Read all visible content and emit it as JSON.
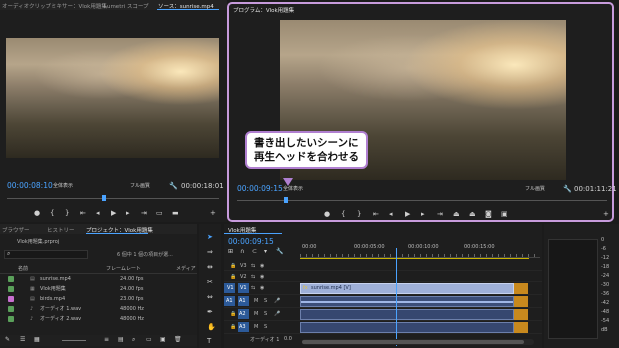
{
  "source_panel": {
    "tabs": [
      "オーディオクリップミキサー：Vlok用題集",
      "Lumetri スコープ",
      "ソース：sunrise.mp4"
    ],
    "timecode_left": "00:00:08:10",
    "fit_label": "全体表示",
    "quality_label": "フル画質",
    "timecode_right": "00:00:18:01"
  },
  "program_panel": {
    "tab": "プログラム：Vlok用題集",
    "timecode_left": "00:00:09:15",
    "fit_label": "全体表示",
    "quality_label": "フル画質",
    "timecode_right": "00:01:11:21"
  },
  "callout": {
    "line1": "書き出したいシーンに",
    "line2": "再生ヘッドを合わせる"
  },
  "project_panel": {
    "tabs": [
      "ブラウザー",
      "ヒストリー",
      "プロジェクト：Vlok用題集"
    ],
    "project_file": "Vlok用題集.prproj",
    "item_count": "6 個中 1 個の項目が選...",
    "columns": [
      "名前",
      "フレームレート",
      "メディア"
    ],
    "items": [
      {
        "name": "sunrise.mp4",
        "rate": "24.00 fps",
        "color": "#5aa05a"
      },
      {
        "name": "Vlok用題集",
        "rate": "24.00 fps",
        "color": "#5aa05a"
      },
      {
        "name": "birds.mp4",
        "rate": "23.00 fps",
        "color": "#c86fd0"
      },
      {
        "name": "オーディオ 1.wav",
        "rate": "48000 Hz",
        "color": "#5aa05a"
      },
      {
        "name": "オーディオ 2.wav",
        "rate": "48000 Hz",
        "color": "#5aa05a"
      }
    ]
  },
  "timeline": {
    "tab": "Vlok用題集",
    "timecode": "00:00:09:15",
    "ruler": [
      "00:00",
      "00:00:05:00",
      "00:00:10:00",
      "00:00:15:00"
    ],
    "video_tracks": [
      "V3",
      "V2",
      "V1"
    ],
    "audio_tracks": [
      "A1",
      "A2",
      "A3"
    ],
    "mix_label": "オーディオ 1",
    "mix_value": "0.0",
    "clip_label": "sunrise.mp4 [V]",
    "playhead_fraction": 0.4
  },
  "meter_labels": [
    "0",
    "-6",
    "-12",
    "-18",
    "-24",
    "-30",
    "-36",
    "-42",
    "-48",
    "-54",
    "dB"
  ],
  "colors": {
    "accent": "#4aa3ff",
    "highlight": "#c79bdc"
  }
}
